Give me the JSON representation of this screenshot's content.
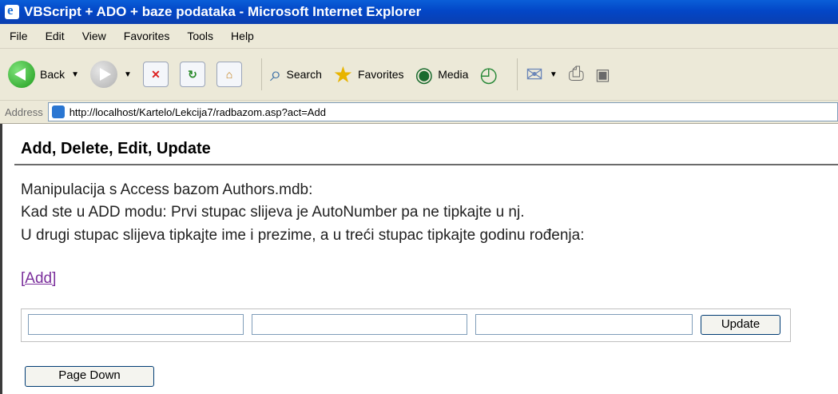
{
  "window": {
    "title": "VBScript + ADO + baze podataka - Microsoft Internet Explorer"
  },
  "menu": [
    "File",
    "Edit",
    "View",
    "Favorites",
    "Tools",
    "Help"
  ],
  "toolbar": {
    "back": "Back",
    "search": "Search",
    "favorites": "Favorites",
    "media": "Media"
  },
  "address": {
    "label": "Address",
    "url": "http://localhost/Kartelo/Lekcija7/radbazom.asp?act=Add"
  },
  "page": {
    "heading": "Add, Delete, Edit, Update",
    "lines": [
      "Manipulacija s Access bazom Authors.mdb:",
      "Kad ste u ADD modu: Prvi stupac slijeva je AutoNumber pa ne tipkajte u nj.",
      "U drugi stupac slijeva tipkajte ime i prezime, a u treći stupac tipkajte godinu rođenja:"
    ],
    "add_link": "[Add]",
    "update_button": "Update",
    "page_down_button": "Page Down"
  },
  "inputs": [
    "",
    "",
    ""
  ]
}
